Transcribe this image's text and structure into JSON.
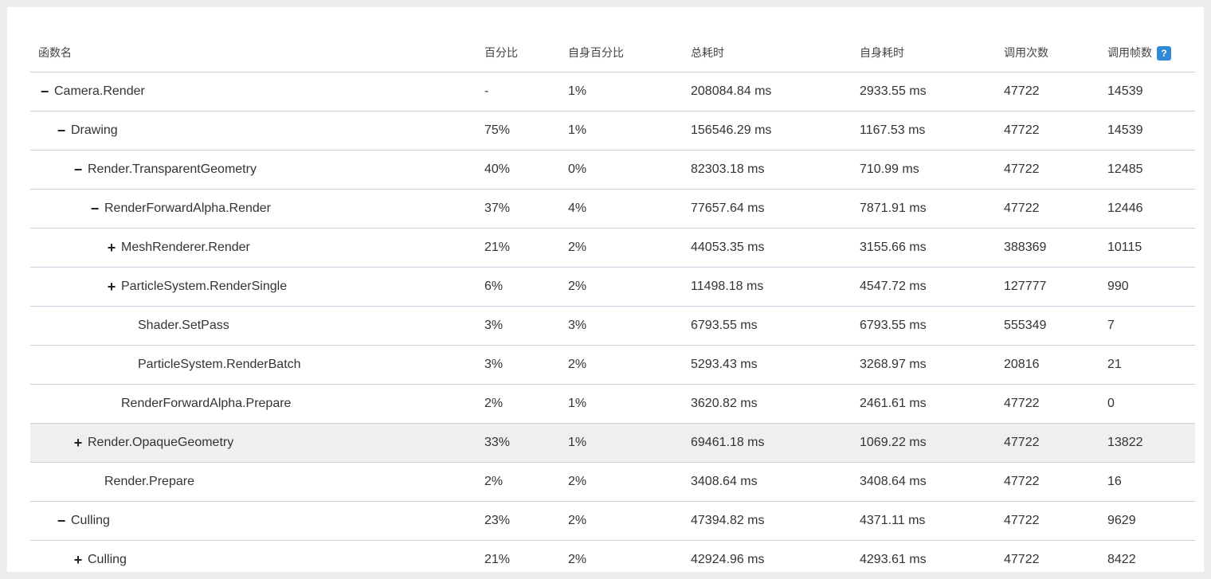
{
  "table": {
    "headers": {
      "name": "函数名",
      "percent": "百分比",
      "self_percent": "自身百分比",
      "total_time": "总耗时",
      "self_time": "自身耗时",
      "calls": "调用次数",
      "frames": "调用帧数"
    },
    "help_icon_glyph": "?",
    "rows": [
      {
        "toggle": "−",
        "name": "Camera.Render",
        "percent": "-",
        "self_percent": "1%",
        "total_time": "208084.84 ms",
        "self_time": "2933.55 ms",
        "calls": "47722",
        "frames": "14539"
      },
      {
        "toggle": "−",
        "name": "Drawing",
        "percent": "75%",
        "self_percent": "1%",
        "total_time": "156546.29 ms",
        "self_time": "1167.53 ms",
        "calls": "47722",
        "frames": "14539"
      },
      {
        "toggle": "−",
        "name": "Render.TransparentGeometry",
        "percent": "40%",
        "self_percent": "0%",
        "total_time": "82303.18 ms",
        "self_time": "710.99 ms",
        "calls": "47722",
        "frames": "12485"
      },
      {
        "toggle": "−",
        "name": "RenderForwardAlpha.Render",
        "percent": "37%",
        "self_percent": "4%",
        "total_time": "77657.64 ms",
        "self_time": "7871.91 ms",
        "calls": "47722",
        "frames": "12446"
      },
      {
        "toggle": "+",
        "name": "MeshRenderer.Render",
        "percent": "21%",
        "self_percent": "2%",
        "total_time": "44053.35 ms",
        "self_time": "3155.66 ms",
        "calls": "388369",
        "frames": "10115"
      },
      {
        "toggle": "+",
        "name": "ParticleSystem.RenderSingle",
        "percent": "6%",
        "self_percent": "2%",
        "total_time": "11498.18 ms",
        "self_time": "4547.72 ms",
        "calls": "127777",
        "frames": "990"
      },
      {
        "toggle": "",
        "name": "Shader.SetPass",
        "percent": "3%",
        "self_percent": "3%",
        "total_time": "6793.55 ms",
        "self_time": "6793.55 ms",
        "calls": "555349",
        "frames": "7"
      },
      {
        "toggle": "",
        "name": "ParticleSystem.RenderBatch",
        "percent": "3%",
        "self_percent": "2%",
        "total_time": "5293.43 ms",
        "self_time": "3268.97 ms",
        "calls": "20816",
        "frames": "21"
      },
      {
        "toggle": "",
        "name": "RenderForwardAlpha.Prepare",
        "percent": "2%",
        "self_percent": "1%",
        "total_time": "3620.82 ms",
        "self_time": "2461.61 ms",
        "calls": "47722",
        "frames": "0"
      },
      {
        "toggle": "+",
        "name": "Render.OpaqueGeometry",
        "percent": "33%",
        "self_percent": "1%",
        "total_time": "69461.18 ms",
        "self_time": "1069.22 ms",
        "calls": "47722",
        "frames": "13822"
      },
      {
        "toggle": "",
        "name": "Render.Prepare",
        "percent": "2%",
        "self_percent": "2%",
        "total_time": "3408.64 ms",
        "self_time": "3408.64 ms",
        "calls": "47722",
        "frames": "16"
      },
      {
        "toggle": "−",
        "name": "Culling",
        "percent": "23%",
        "self_percent": "2%",
        "total_time": "47394.82 ms",
        "self_time": "4371.11 ms",
        "calls": "47722",
        "frames": "9629"
      },
      {
        "toggle": "+",
        "name": "Culling",
        "percent": "21%",
        "self_percent": "2%",
        "total_time": "42924.96 ms",
        "self_time": "4293.61 ms",
        "calls": "47722",
        "frames": "8422"
      }
    ]
  }
}
